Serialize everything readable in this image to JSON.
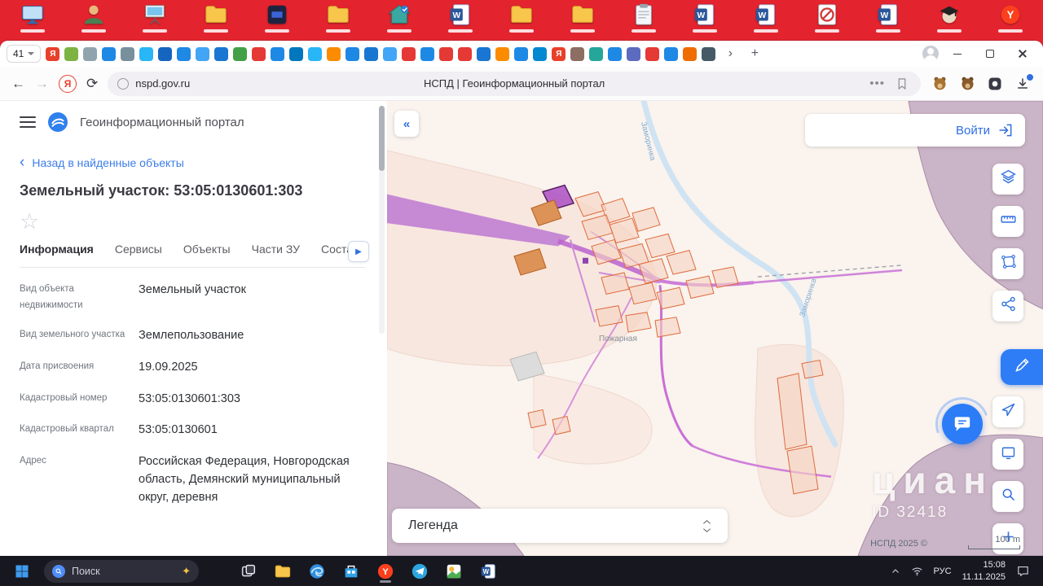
{
  "desktop": {
    "icons": [
      "monitor",
      "user",
      "presentation",
      "folder",
      "appdark",
      "folder",
      "house",
      "word",
      "folder",
      "folder",
      "clipboard",
      "word",
      "word",
      "blocked",
      "word",
      "graduate",
      "yandex"
    ]
  },
  "browser": {
    "tab_counter": "41",
    "tab_favicons": [
      {
        "c": "#e8402a",
        "t": "Я"
      },
      {
        "c": "#7cb342"
      },
      {
        "c": "#90a4ae"
      },
      {
        "c": "#1e88e5"
      },
      {
        "c": "#78909c"
      },
      {
        "c": "#29b6f6"
      },
      {
        "c": "#1565c0"
      },
      {
        "c": "#1e88e5"
      },
      {
        "c": "#42a5f5"
      },
      {
        "c": "#1976d2"
      },
      {
        "c": "#43a047"
      },
      {
        "c": "#e53935"
      },
      {
        "c": "#1e88e5"
      },
      {
        "c": "#0277bd"
      },
      {
        "c": "#29b6f6"
      },
      {
        "c": "#fb8c00"
      },
      {
        "c": "#1e88e5"
      },
      {
        "c": "#1976d2"
      },
      {
        "c": "#42a5f5"
      },
      {
        "c": "#e53935"
      },
      {
        "c": "#1e88e5"
      },
      {
        "c": "#e53935"
      },
      {
        "c": "#e53935"
      },
      {
        "c": "#1976d2"
      },
      {
        "c": "#fb8c00"
      },
      {
        "c": "#1e88e5"
      },
      {
        "c": "#0288d1"
      },
      {
        "c": "#e8402a",
        "t": "Я"
      },
      {
        "c": "#8d6e63"
      },
      {
        "c": "#26a69a"
      },
      {
        "c": "#1e88e5"
      },
      {
        "c": "#5c6bc0"
      },
      {
        "c": "#e53935"
      },
      {
        "c": "#1e88e5"
      },
      {
        "c": "#ef6c00"
      },
      {
        "c": "#455a64"
      }
    ],
    "address": "nspd.gov.ru",
    "page_title": "НСПД | Геоинформационный портал"
  },
  "panel": {
    "portal_title": "Геоинформационный портал",
    "back_link": "Назад в найденные объекты",
    "object_title": "Земельный участок: 53:05:0130601:303",
    "tabs": [
      {
        "label": "Информация",
        "active": true
      },
      {
        "label": "Сервисы"
      },
      {
        "label": "Объекты"
      },
      {
        "label": "Части ЗУ"
      },
      {
        "label": "Соста"
      }
    ],
    "fields": [
      {
        "label": "Вид объекта недвижимости",
        "value": "Земельный участок"
      },
      {
        "label": "Вид земельного участка",
        "value": "Землепользование"
      },
      {
        "label": "Дата присвоения",
        "value": "19.09.2025"
      },
      {
        "label": "Кадастровый номер",
        "value": "53:05:0130601:303"
      },
      {
        "label": "Кадастровый квартал",
        "value": "53:05:0130601"
      },
      {
        "label": "Адрес",
        "value": "Российская Федерация, Новгородская область, Демянский муниципальный округ, деревня"
      }
    ]
  },
  "map": {
    "login_label": "Войти",
    "legend_label": "Легенда",
    "copyright": "НСПД 2025 ©",
    "scale_label": "100 m",
    "river_label": "Заморинка",
    "place_label": "Пожарная",
    "watermark_brand": "циан",
    "watermark_id": "ID 32418",
    "toolbar": [
      "layers",
      "ruler",
      "measure-area",
      "share",
      "draw",
      "locate",
      "extent",
      "search",
      "zoom-in"
    ]
  },
  "taskbar": {
    "search_placeholder": "Поиск",
    "apps": [
      "taskview",
      "folder",
      "edge",
      "store",
      "yandex",
      "telegram",
      "photos",
      "word"
    ],
    "lang": "РУС",
    "time": "15:08",
    "date": "11.11.2025"
  }
}
